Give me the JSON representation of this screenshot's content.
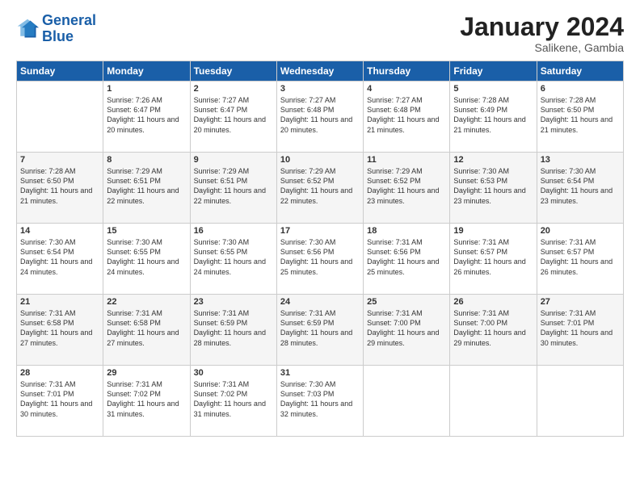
{
  "header": {
    "logo_general": "General",
    "logo_blue": "Blue",
    "title": "January 2024",
    "subtitle": "Salikene, Gambia"
  },
  "days_of_week": [
    "Sunday",
    "Monday",
    "Tuesday",
    "Wednesday",
    "Thursday",
    "Friday",
    "Saturday"
  ],
  "weeks": [
    [
      {
        "day": "",
        "sunrise": "",
        "sunset": "",
        "daylight": ""
      },
      {
        "day": "1",
        "sunrise": "7:26 AM",
        "sunset": "6:47 PM",
        "daylight": "11 hours and 20 minutes."
      },
      {
        "day": "2",
        "sunrise": "7:27 AM",
        "sunset": "6:47 PM",
        "daylight": "11 hours and 20 minutes."
      },
      {
        "day": "3",
        "sunrise": "7:27 AM",
        "sunset": "6:48 PM",
        "daylight": "11 hours and 20 minutes."
      },
      {
        "day": "4",
        "sunrise": "7:27 AM",
        "sunset": "6:48 PM",
        "daylight": "11 hours and 21 minutes."
      },
      {
        "day": "5",
        "sunrise": "7:28 AM",
        "sunset": "6:49 PM",
        "daylight": "11 hours and 21 minutes."
      },
      {
        "day": "6",
        "sunrise": "7:28 AM",
        "sunset": "6:50 PM",
        "daylight": "11 hours and 21 minutes."
      }
    ],
    [
      {
        "day": "7",
        "sunrise": "7:28 AM",
        "sunset": "6:50 PM",
        "daylight": "11 hours and 21 minutes."
      },
      {
        "day": "8",
        "sunrise": "7:29 AM",
        "sunset": "6:51 PM",
        "daylight": "11 hours and 22 minutes."
      },
      {
        "day": "9",
        "sunrise": "7:29 AM",
        "sunset": "6:51 PM",
        "daylight": "11 hours and 22 minutes."
      },
      {
        "day": "10",
        "sunrise": "7:29 AM",
        "sunset": "6:52 PM",
        "daylight": "11 hours and 22 minutes."
      },
      {
        "day": "11",
        "sunrise": "7:29 AM",
        "sunset": "6:52 PM",
        "daylight": "11 hours and 23 minutes."
      },
      {
        "day": "12",
        "sunrise": "7:30 AM",
        "sunset": "6:53 PM",
        "daylight": "11 hours and 23 minutes."
      },
      {
        "day": "13",
        "sunrise": "7:30 AM",
        "sunset": "6:54 PM",
        "daylight": "11 hours and 23 minutes."
      }
    ],
    [
      {
        "day": "14",
        "sunrise": "7:30 AM",
        "sunset": "6:54 PM",
        "daylight": "11 hours and 24 minutes."
      },
      {
        "day": "15",
        "sunrise": "7:30 AM",
        "sunset": "6:55 PM",
        "daylight": "11 hours and 24 minutes."
      },
      {
        "day": "16",
        "sunrise": "7:30 AM",
        "sunset": "6:55 PM",
        "daylight": "11 hours and 24 minutes."
      },
      {
        "day": "17",
        "sunrise": "7:30 AM",
        "sunset": "6:56 PM",
        "daylight": "11 hours and 25 minutes."
      },
      {
        "day": "18",
        "sunrise": "7:31 AM",
        "sunset": "6:56 PM",
        "daylight": "11 hours and 25 minutes."
      },
      {
        "day": "19",
        "sunrise": "7:31 AM",
        "sunset": "6:57 PM",
        "daylight": "11 hours and 26 minutes."
      },
      {
        "day": "20",
        "sunrise": "7:31 AM",
        "sunset": "6:57 PM",
        "daylight": "11 hours and 26 minutes."
      }
    ],
    [
      {
        "day": "21",
        "sunrise": "7:31 AM",
        "sunset": "6:58 PM",
        "daylight": "11 hours and 27 minutes."
      },
      {
        "day": "22",
        "sunrise": "7:31 AM",
        "sunset": "6:58 PM",
        "daylight": "11 hours and 27 minutes."
      },
      {
        "day": "23",
        "sunrise": "7:31 AM",
        "sunset": "6:59 PM",
        "daylight": "11 hours and 28 minutes."
      },
      {
        "day": "24",
        "sunrise": "7:31 AM",
        "sunset": "6:59 PM",
        "daylight": "11 hours and 28 minutes."
      },
      {
        "day": "25",
        "sunrise": "7:31 AM",
        "sunset": "7:00 PM",
        "daylight": "11 hours and 29 minutes."
      },
      {
        "day": "26",
        "sunrise": "7:31 AM",
        "sunset": "7:00 PM",
        "daylight": "11 hours and 29 minutes."
      },
      {
        "day": "27",
        "sunrise": "7:31 AM",
        "sunset": "7:01 PM",
        "daylight": "11 hours and 30 minutes."
      }
    ],
    [
      {
        "day": "28",
        "sunrise": "7:31 AM",
        "sunset": "7:01 PM",
        "daylight": "11 hours and 30 minutes."
      },
      {
        "day": "29",
        "sunrise": "7:31 AM",
        "sunset": "7:02 PM",
        "daylight": "11 hours and 31 minutes."
      },
      {
        "day": "30",
        "sunrise": "7:31 AM",
        "sunset": "7:02 PM",
        "daylight": "11 hours and 31 minutes."
      },
      {
        "day": "31",
        "sunrise": "7:30 AM",
        "sunset": "7:03 PM",
        "daylight": "11 hours and 32 minutes."
      },
      {
        "day": "",
        "sunrise": "",
        "sunset": "",
        "daylight": ""
      },
      {
        "day": "",
        "sunrise": "",
        "sunset": "",
        "daylight": ""
      },
      {
        "day": "",
        "sunrise": "",
        "sunset": "",
        "daylight": ""
      }
    ]
  ]
}
